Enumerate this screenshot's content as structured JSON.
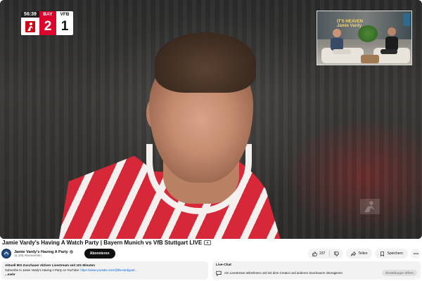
{
  "scoreboard": {
    "time": "56:39",
    "home_abbr": "BAY",
    "home_score": "2",
    "away_abbr": "VFB",
    "away_score": "1"
  },
  "pip": {
    "sign_line1": "IT'S HEAVEN",
    "sign_line2": "Jamie Vardy"
  },
  "video": {
    "title": "Jamie Vardy's Having A Watch Party | Bayern Munich vs VfB Stuttgart LIVE"
  },
  "channel": {
    "name": "Jamie Vardy's Having A Party",
    "subscribers": "11.100 Abonnenten",
    "subscribe_label": "Abonnieren"
  },
  "actions": {
    "like_count": "237",
    "share_label": "Teilen",
    "save_label": "Speichern"
  },
  "description": {
    "stats": "Aktuell 902 Zuschauer  Aktiver Livestream seit 101 Minuten",
    "line_prefix": "Subscribe to Jamie Vardy's Having A Party on YouTube: ",
    "link": "https://www.youtube.com/@thevardypart...",
    "more_label": "...mehr"
  },
  "live_chat": {
    "title": "Live-Chat",
    "text": "Am Livestream teilnehmen und mit dem Creator und anderen Zuschauern interagieren",
    "button_label": "Einstellungen öffnen"
  },
  "colors": {
    "bayern_red": "#dc052d",
    "link_blue": "#065fd4",
    "chip_bg": "#f2f2f2"
  }
}
